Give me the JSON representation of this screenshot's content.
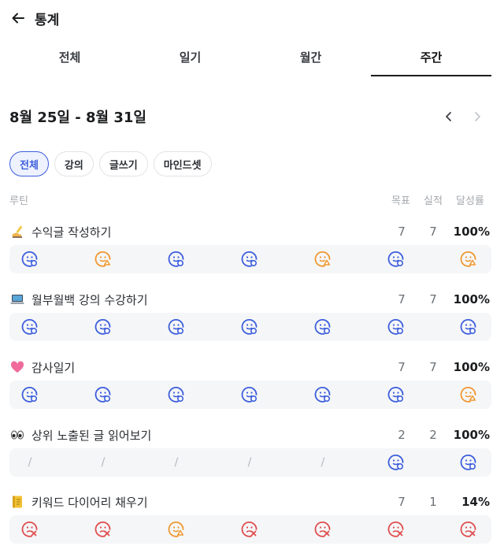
{
  "header": {
    "title": "통계"
  },
  "tabs": [
    {
      "label": "전체",
      "active": false
    },
    {
      "label": "일기",
      "active": false
    },
    {
      "label": "월간",
      "active": false
    },
    {
      "label": "주간",
      "active": true
    }
  ],
  "range": {
    "label": "8월 25일 - 8월 31일"
  },
  "chips": [
    {
      "label": "전체",
      "active": true
    },
    {
      "label": "강의",
      "active": false
    },
    {
      "label": "글쓰기",
      "active": false
    },
    {
      "label": "마인드셋",
      "active": false
    }
  ],
  "columns": {
    "routine": "루틴",
    "goal": "목표",
    "actual": "실적",
    "rate": "달성률"
  },
  "colors": {
    "done": "#3b5ddc",
    "partial": "#f0972f",
    "missed": "#e04d4d",
    "slash": "#b4b8bd"
  },
  "routines": [
    {
      "emoji": "writing-hand",
      "name": "수익글 작성하기",
      "goal": "7",
      "actual": "7",
      "rate": "100%",
      "days": [
        "done",
        "partial",
        "done",
        "done",
        "partial",
        "done",
        "partial"
      ]
    },
    {
      "emoji": "laptop",
      "name": "월부월백 강의 수강하기",
      "goal": "7",
      "actual": "7",
      "rate": "100%",
      "days": [
        "done",
        "done",
        "done",
        "done",
        "done",
        "done",
        "done"
      ]
    },
    {
      "emoji": "pink-heart",
      "name": "감사일기",
      "goal": "7",
      "actual": "7",
      "rate": "100%",
      "days": [
        "done",
        "done",
        "done",
        "done",
        "done",
        "done",
        "partial"
      ]
    },
    {
      "emoji": "eyes",
      "name": "상위 노출된 글 읽어보기",
      "goal": "2",
      "actual": "2",
      "rate": "100%",
      "days": [
        "none",
        "none",
        "none",
        "none",
        "none",
        "done",
        "done"
      ]
    },
    {
      "emoji": "notebook",
      "name": "키워드 다이어리 채우기",
      "goal": "7",
      "actual": "1",
      "rate": "14%",
      "days": [
        "missed",
        "missed",
        "partial",
        "missed",
        "missed",
        "missed",
        "missed"
      ]
    }
  ],
  "empty_day_mark": "/"
}
